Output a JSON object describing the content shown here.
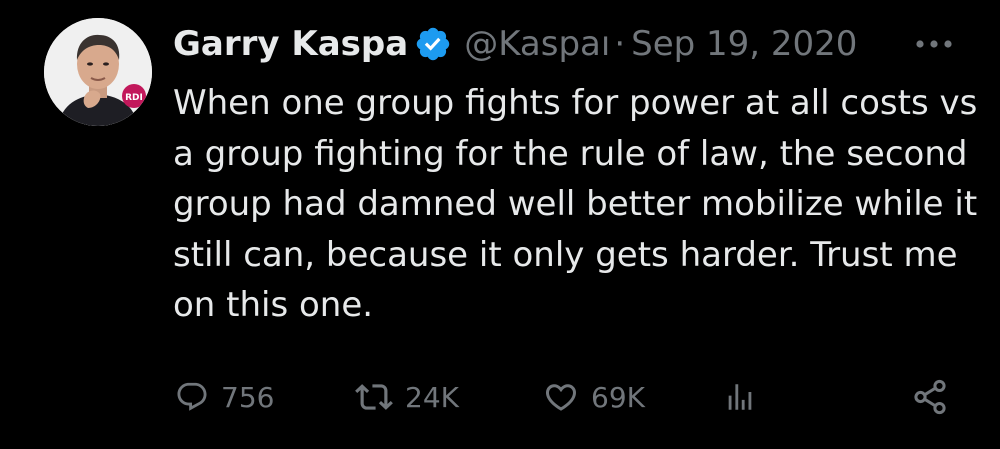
{
  "tweet": {
    "author": {
      "display_name": "Garry Kaspa",
      "handle": "@Kaspaı",
      "verified": true,
      "avatar_badge": "RDI"
    },
    "separator": "·",
    "date": "Sep 19, 2020",
    "text": "When one group fights for power at all costs vs a group fighting for the rule of law, the second group had damned well better mobilize while it still can, because it only gets harder. Trust me on this one.",
    "actions": {
      "replies": "756",
      "retweets": "24K",
      "likes": "69K"
    }
  },
  "colors": {
    "background": "#000000",
    "text_primary": "#e7e9ea",
    "text_secondary": "#71767b",
    "verified_blue": "#1d9bf0",
    "badge_pink": "#c2185b"
  },
  "icons": {
    "more": "more-horizontal-icon",
    "reply": "speech-bubble-icon",
    "retweet": "retweet-arrows-icon",
    "like": "heart-icon",
    "views": "bar-chart-icon",
    "share": "share-nodes-icon",
    "verified": "verified-badge-icon"
  }
}
